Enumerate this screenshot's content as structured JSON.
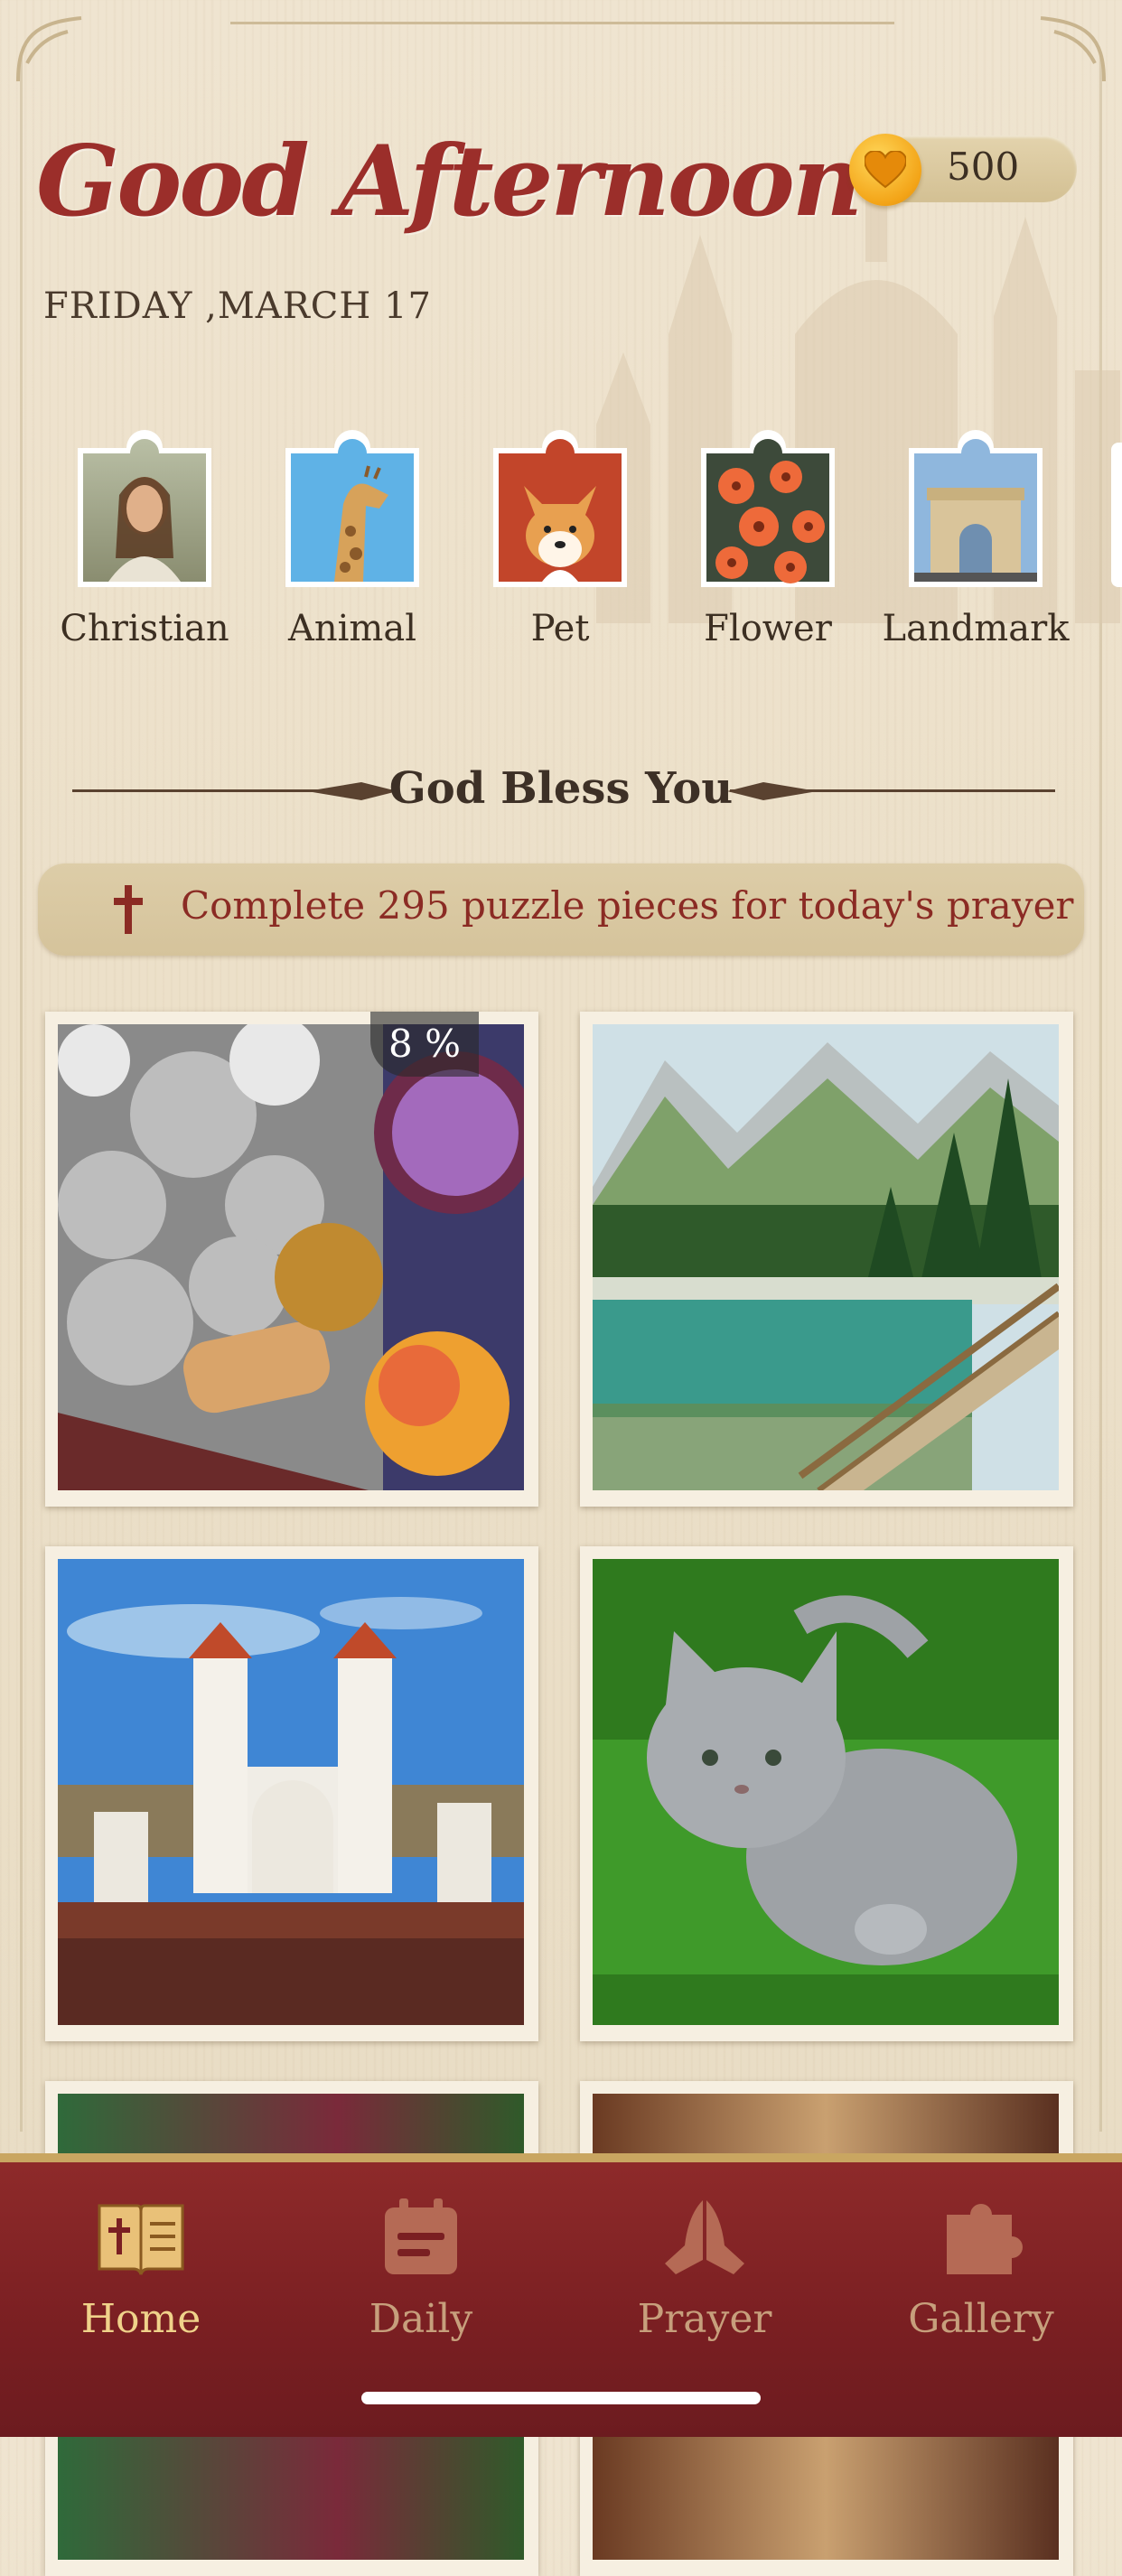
{
  "header": {
    "greeting": "Good Afternoon",
    "date": "FRIDAY ,MARCH 17"
  },
  "coins": {
    "value": "500",
    "icon": "heart-coin-icon"
  },
  "categories": [
    {
      "label": "Christian",
      "icon": "jesus-puzzle-icon"
    },
    {
      "label": "Animal",
      "icon": "giraffe-puzzle-icon"
    },
    {
      "label": "Pet",
      "icon": "dog-puzzle-icon"
    },
    {
      "label": "Flower",
      "icon": "flower-puzzle-icon"
    },
    {
      "label": "Landmark",
      "icon": "arch-puzzle-icon"
    }
  ],
  "section": {
    "title": "God Bless You"
  },
  "prayer_banner": {
    "text": "Complete 295 puzzle pieces for today's prayer",
    "icon": "cross-icon"
  },
  "puzzles": [
    {
      "name": "pastry-puzzle",
      "progress": "8 %"
    },
    {
      "name": "mountain-lake-puzzle"
    },
    {
      "name": "white-church-puzzle"
    },
    {
      "name": "gray-kitten-puzzle"
    }
  ],
  "tabs": [
    {
      "label": "Home",
      "icon": "bible-icon",
      "active": true
    },
    {
      "label": "Daily",
      "icon": "calendar-icon",
      "active": false
    },
    {
      "label": "Prayer",
      "icon": "praying-hands-icon",
      "active": false
    },
    {
      "label": "Gallery",
      "icon": "puzzle-piece-icon",
      "active": false
    }
  ],
  "colors": {
    "accent_red": "#9b2e2a",
    "tab_bar": "#7a1f22",
    "gold": "#f0d28a"
  }
}
